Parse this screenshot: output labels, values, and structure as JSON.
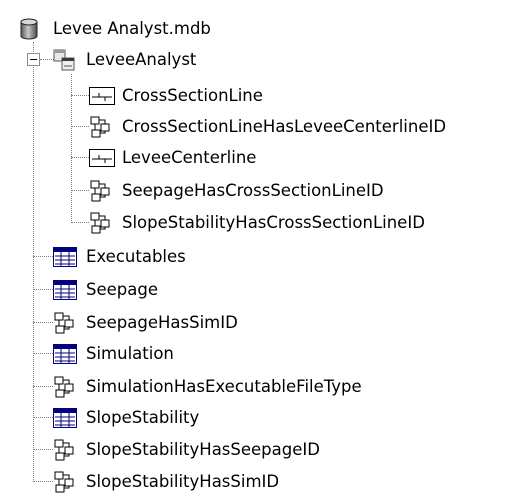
{
  "tree": {
    "root": {
      "label": "Levee Analyst.mdb",
      "icon": "database-icon"
    },
    "dataset": {
      "label": "LeveeAnalyst",
      "icon": "feature-dataset-icon",
      "expanded": true,
      "children": [
        {
          "label": "CrossSectionLine",
          "icon": "line-feature-class-icon"
        },
        {
          "label": "CrossSectionLineHasLeveeCenterlineID",
          "icon": "relationship-class-icon"
        },
        {
          "label": "LeveeCenterline",
          "icon": "line-feature-class-icon"
        },
        {
          "label": "SeepageHasCrossSectionLineID",
          "icon": "relationship-class-icon"
        },
        {
          "label": "SlopeStabilityHasCrossSectionLineID",
          "icon": "relationship-class-icon"
        }
      ]
    },
    "items": [
      {
        "label": "Executables",
        "icon": "table-icon"
      },
      {
        "label": "Seepage",
        "icon": "table-icon"
      },
      {
        "label": "SeepageHasSimID",
        "icon": "relationship-class-icon"
      },
      {
        "label": "Simulation",
        "icon": "table-icon"
      },
      {
        "label": "SimulationHasExecutableFileType",
        "icon": "relationship-class-icon"
      },
      {
        "label": "SlopeStability",
        "icon": "table-icon"
      },
      {
        "label": "SlopeStabilityHasSeepageID",
        "icon": "relationship-class-icon"
      },
      {
        "label": "SlopeStabilityHasSimID",
        "icon": "relationship-class-icon"
      }
    ]
  }
}
